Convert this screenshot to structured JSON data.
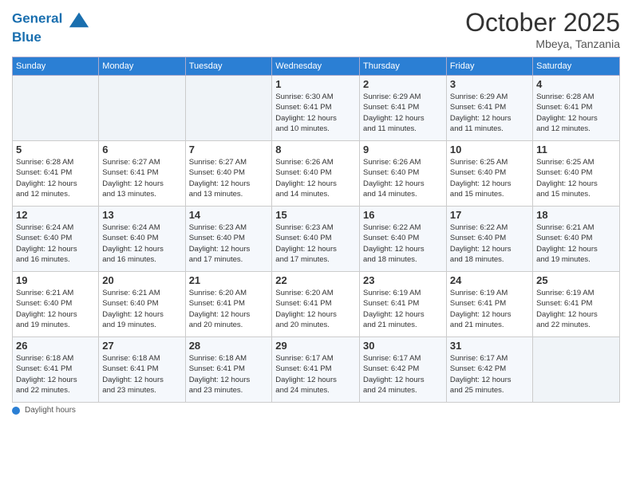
{
  "logo": {
    "line1": "General",
    "line2": "Blue"
  },
  "title": "October 2025",
  "subtitle": "Mbeya, Tanzania",
  "days_of_week": [
    "Sunday",
    "Monday",
    "Tuesday",
    "Wednesday",
    "Thursday",
    "Friday",
    "Saturday"
  ],
  "weeks": [
    [
      {
        "day": "",
        "info": ""
      },
      {
        "day": "",
        "info": ""
      },
      {
        "day": "",
        "info": ""
      },
      {
        "day": "1",
        "info": "Sunrise: 6:30 AM\nSunset: 6:41 PM\nDaylight: 12 hours\nand 10 minutes."
      },
      {
        "day": "2",
        "info": "Sunrise: 6:29 AM\nSunset: 6:41 PM\nDaylight: 12 hours\nand 11 minutes."
      },
      {
        "day": "3",
        "info": "Sunrise: 6:29 AM\nSunset: 6:41 PM\nDaylight: 12 hours\nand 11 minutes."
      },
      {
        "day": "4",
        "info": "Sunrise: 6:28 AM\nSunset: 6:41 PM\nDaylight: 12 hours\nand 12 minutes."
      }
    ],
    [
      {
        "day": "5",
        "info": "Sunrise: 6:28 AM\nSunset: 6:41 PM\nDaylight: 12 hours\nand 12 minutes."
      },
      {
        "day": "6",
        "info": "Sunrise: 6:27 AM\nSunset: 6:41 PM\nDaylight: 12 hours\nand 13 minutes."
      },
      {
        "day": "7",
        "info": "Sunrise: 6:27 AM\nSunset: 6:40 PM\nDaylight: 12 hours\nand 13 minutes."
      },
      {
        "day": "8",
        "info": "Sunrise: 6:26 AM\nSunset: 6:40 PM\nDaylight: 12 hours\nand 14 minutes."
      },
      {
        "day": "9",
        "info": "Sunrise: 6:26 AM\nSunset: 6:40 PM\nDaylight: 12 hours\nand 14 minutes."
      },
      {
        "day": "10",
        "info": "Sunrise: 6:25 AM\nSunset: 6:40 PM\nDaylight: 12 hours\nand 15 minutes."
      },
      {
        "day": "11",
        "info": "Sunrise: 6:25 AM\nSunset: 6:40 PM\nDaylight: 12 hours\nand 15 minutes."
      }
    ],
    [
      {
        "day": "12",
        "info": "Sunrise: 6:24 AM\nSunset: 6:40 PM\nDaylight: 12 hours\nand 16 minutes."
      },
      {
        "day": "13",
        "info": "Sunrise: 6:24 AM\nSunset: 6:40 PM\nDaylight: 12 hours\nand 16 minutes."
      },
      {
        "day": "14",
        "info": "Sunrise: 6:23 AM\nSunset: 6:40 PM\nDaylight: 12 hours\nand 17 minutes."
      },
      {
        "day": "15",
        "info": "Sunrise: 6:23 AM\nSunset: 6:40 PM\nDaylight: 12 hours\nand 17 minutes."
      },
      {
        "day": "16",
        "info": "Sunrise: 6:22 AM\nSunset: 6:40 PM\nDaylight: 12 hours\nand 18 minutes."
      },
      {
        "day": "17",
        "info": "Sunrise: 6:22 AM\nSunset: 6:40 PM\nDaylight: 12 hours\nand 18 minutes."
      },
      {
        "day": "18",
        "info": "Sunrise: 6:21 AM\nSunset: 6:40 PM\nDaylight: 12 hours\nand 19 minutes."
      }
    ],
    [
      {
        "day": "19",
        "info": "Sunrise: 6:21 AM\nSunset: 6:40 PM\nDaylight: 12 hours\nand 19 minutes."
      },
      {
        "day": "20",
        "info": "Sunrise: 6:21 AM\nSunset: 6:40 PM\nDaylight: 12 hours\nand 19 minutes."
      },
      {
        "day": "21",
        "info": "Sunrise: 6:20 AM\nSunset: 6:41 PM\nDaylight: 12 hours\nand 20 minutes."
      },
      {
        "day": "22",
        "info": "Sunrise: 6:20 AM\nSunset: 6:41 PM\nDaylight: 12 hours\nand 20 minutes."
      },
      {
        "day": "23",
        "info": "Sunrise: 6:19 AM\nSunset: 6:41 PM\nDaylight: 12 hours\nand 21 minutes."
      },
      {
        "day": "24",
        "info": "Sunrise: 6:19 AM\nSunset: 6:41 PM\nDaylight: 12 hours\nand 21 minutes."
      },
      {
        "day": "25",
        "info": "Sunrise: 6:19 AM\nSunset: 6:41 PM\nDaylight: 12 hours\nand 22 minutes."
      }
    ],
    [
      {
        "day": "26",
        "info": "Sunrise: 6:18 AM\nSunset: 6:41 PM\nDaylight: 12 hours\nand 22 minutes."
      },
      {
        "day": "27",
        "info": "Sunrise: 6:18 AM\nSunset: 6:41 PM\nDaylight: 12 hours\nand 23 minutes."
      },
      {
        "day": "28",
        "info": "Sunrise: 6:18 AM\nSunset: 6:41 PM\nDaylight: 12 hours\nand 23 minutes."
      },
      {
        "day": "29",
        "info": "Sunrise: 6:17 AM\nSunset: 6:41 PM\nDaylight: 12 hours\nand 24 minutes."
      },
      {
        "day": "30",
        "info": "Sunrise: 6:17 AM\nSunset: 6:42 PM\nDaylight: 12 hours\nand 24 minutes."
      },
      {
        "day": "31",
        "info": "Sunrise: 6:17 AM\nSunset: 6:42 PM\nDaylight: 12 hours\nand 25 minutes."
      },
      {
        "day": "",
        "info": ""
      }
    ]
  ],
  "footer": {
    "label": "Daylight hours"
  }
}
